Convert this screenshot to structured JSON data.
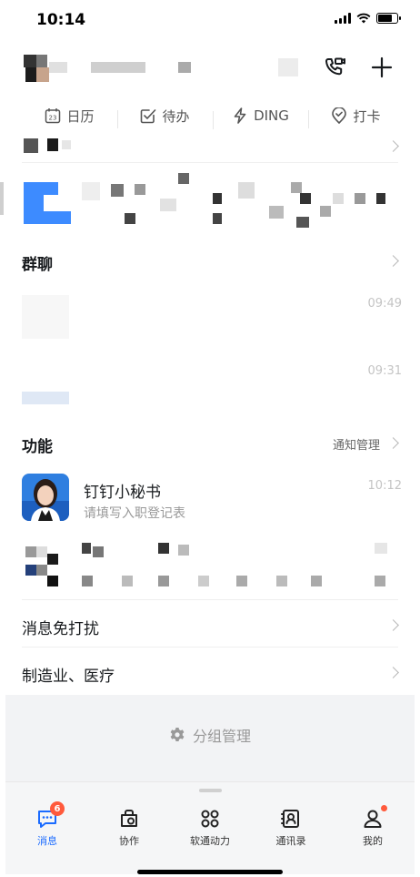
{
  "status_bar": {
    "time": "10:14"
  },
  "shortcuts": [
    {
      "label": "日历",
      "icon": "calendar-icon"
    },
    {
      "label": "待办",
      "icon": "todo-check-icon"
    },
    {
      "label": "DING",
      "icon": "lightning-icon"
    },
    {
      "label": "打卡",
      "icon": "location-check-icon"
    }
  ],
  "sections": {
    "group_chat": {
      "title": "群聊",
      "items": [
        {
          "time": "09:49"
        },
        {
          "time": "09:31"
        }
      ]
    },
    "features": {
      "title": "功能",
      "manage_link": "通知管理",
      "items": [
        {
          "name": "钉钉小秘书",
          "subtitle": "请填写入职登记表",
          "time": "10:12"
        }
      ]
    },
    "mute": {
      "title": "消息免打扰"
    },
    "industry": {
      "title": "制造业、医疗"
    }
  },
  "group_manage": {
    "label": "分组管理",
    "icon": "gear-icon"
  },
  "tabbar": {
    "tabs": [
      {
        "label": "消息",
        "icon": "message-icon",
        "active": true,
        "badge": "6"
      },
      {
        "label": "协作",
        "icon": "collab-icon"
      },
      {
        "label": "软通动力",
        "icon": "apps-grid-icon"
      },
      {
        "label": "通讯录",
        "icon": "contacts-icon"
      },
      {
        "label": "我的",
        "icon": "profile-icon",
        "dot": true
      }
    ]
  },
  "colors": {
    "accent": "#1a6bff",
    "badge": "#ff5a3c",
    "bg_gray": "#f2f3f5"
  }
}
